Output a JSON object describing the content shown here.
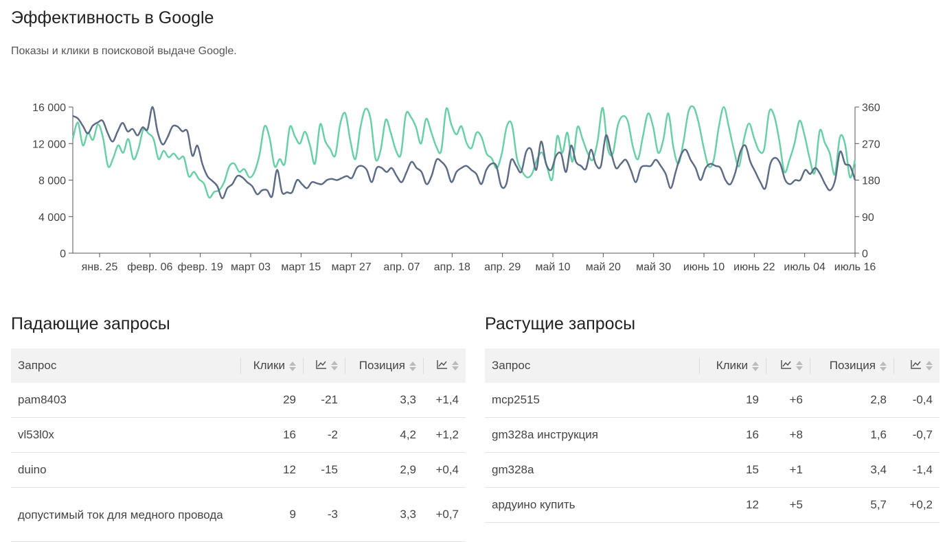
{
  "page": {
    "title": "Эффективность в Google",
    "subtitle": "Показы и клики в поисковой выдаче Google."
  },
  "colors": {
    "impressions": "#69d0a6",
    "clicks": "#5c6c85",
    "negative": "#c0392b",
    "positive": "#6aaa1e"
  },
  "chart_data": {
    "type": "line",
    "categories": [
      "янв. 25",
      "февр. 06",
      "февр. 19",
      "март 03",
      "март 15",
      "март 27",
      "апр. 07",
      "апр. 18",
      "апр. 29",
      "май 10",
      "май 20",
      "май 30",
      "июнь 10",
      "июнь 22",
      "июль 04",
      "июль 16"
    ],
    "y_left": {
      "ylim": [
        0,
        16000
      ],
      "ticks": [
        "0",
        "4 000",
        "8 000",
        "12 000",
        "16 000"
      ]
    },
    "y_right": {
      "ylim": [
        0,
        360
      ],
      "ticks": [
        "0",
        "90",
        "180",
        "270",
        "360"
      ]
    },
    "grid": false,
    "series": [
      {
        "axis": "left",
        "color": "#69d0a6",
        "values": [
          12500,
          14300,
          11800,
          13200,
          12400,
          14100,
          12600,
          9500,
          10400,
          11800,
          11000,
          12500,
          10300,
          11400,
          13600,
          13100,
          12500,
          10300,
          11200,
          10500,
          10900,
          10300,
          10500,
          8400,
          8900,
          8100,
          7600,
          6100,
          6700,
          6900,
          7800,
          9500,
          9800,
          8900,
          9200,
          8300,
          8900,
          10800,
          13900,
          12600,
          9500,
          10300,
          9800,
          13800,
          12800,
          12000,
          13300,
          11800,
          9800,
          14100,
          12300,
          11400,
          10700,
          14200,
          15300,
          12300,
          10300,
          13800,
          15800,
          14700,
          10300,
          11300,
          14600,
          13200,
          11300,
          10800,
          15200,
          14900,
          13800,
          12000,
          14700,
          13300,
          11700,
          11200,
          15800,
          14100,
          13000,
          13900,
          12100,
          11500,
          13200,
          12700,
          10900,
          10400,
          9300,
          10900,
          13900,
          14100,
          10400,
          9000,
          8300,
          8700,
          10300,
          11000,
          9400,
          8100,
          12800,
          11000,
          13200,
          10000,
          13800,
          12500,
          11000,
          10200,
          12300,
          15900,
          11500,
          10900,
          14000,
          15000,
          14400,
          11600,
          10300,
          12900,
          15300,
          13800,
          11000,
          12400,
          15300,
          11600,
          9800,
          12200,
          15500,
          16000,
          14300,
          11600,
          9500,
          10200,
          13800,
          16000,
          13800,
          11300,
          9500,
          12500,
          14200,
          12600,
          11200,
          11400,
          15500,
          15000,
          12300,
          8900,
          10200,
          12000,
          14500,
          12900,
          10400,
          8800,
          13400,
          12100,
          10900,
          8600,
          12700,
          12000,
          8300,
          10200
        ],
        "name": ""
      },
      {
        "axis": "right",
        "color": "#5c6c85",
        "values": [
          338,
          332,
          314,
          295,
          314,
          322,
          326,
          296,
          275,
          300,
          321,
          300,
          306,
          290,
          310,
          305,
          360,
          300,
          268,
          285,
          312,
          312,
          300,
          300,
          240,
          265,
          220,
          190,
          178,
          165,
          135,
          160,
          170,
          190,
          187,
          175,
          165,
          145,
          155,
          155,
          140,
          205,
          150,
          150,
          150,
          180,
          170,
          160,
          175,
          172,
          170,
          180,
          183,
          180,
          185,
          190,
          185,
          210,
          215,
          205,
          175,
          210,
          210,
          200,
          210,
          190,
          175,
          200,
          225,
          210,
          200,
          170,
          190,
          230,
          225,
          210,
          175,
          200,
          210,
          215,
          205,
          195,
          170,
          205,
          220,
          215,
          165,
          170,
          230,
          215,
          200,
          250,
          255,
          205,
          275,
          220,
          205,
          240,
          245,
          200,
          265,
          225,
          215,
          208,
          255,
          218,
          215,
          290,
          250,
          210,
          220,
          230,
          205,
          175,
          210,
          215,
          215,
          230,
          215,
          195,
          160,
          200,
          240,
          255,
          230,
          210,
          180,
          210,
          220,
          215,
          210,
          180,
          170,
          200,
          250,
          265,
          225,
          200,
          175,
          160,
          220,
          235,
          220,
          180,
          170,
          180,
          180,
          205,
          195,
          210,
          195,
          170,
          155,
          180,
          250,
          220,
          215,
          180
        ],
        "name": ""
      }
    ]
  },
  "falling": {
    "title": "Падающие запросы",
    "headers": {
      "query": "Запрос",
      "clicks": "Клики",
      "position": "Позиция"
    },
    "rows": [
      {
        "query": "pam8403",
        "clicks": "29",
        "clicks_delta": "-21",
        "position": "3,3",
        "position_delta": "+1,4"
      },
      {
        "query": "vl53l0x",
        "clicks": "16",
        "clicks_delta": "-2",
        "position": "4,2",
        "position_delta": "+1,2"
      },
      {
        "query": "duino",
        "clicks": "12",
        "clicks_delta": "-15",
        "position": "2,9",
        "position_delta": "+0,4"
      },
      {
        "query": "допустимый ток для медного провода",
        "clicks": "9",
        "clicks_delta": "-3",
        "position": "3,3",
        "position_delta": "+0,7"
      }
    ]
  },
  "rising": {
    "title": "Растущие запросы",
    "headers": {
      "query": "Запрос",
      "clicks": "Клики",
      "position": "Позиция"
    },
    "rows": [
      {
        "query": "mcp2515",
        "clicks": "19",
        "clicks_delta": "+6",
        "position": "2,8",
        "position_delta": "-0,4"
      },
      {
        "query": "gm328a инструкция",
        "clicks": "16",
        "clicks_delta": "+8",
        "position": "1,6",
        "position_delta": "-0,7"
      },
      {
        "query": "gm328a",
        "clicks": "15",
        "clicks_delta": "+1",
        "position": "3,4",
        "position_delta": "-1,4"
      },
      {
        "query": "ардуино купить",
        "clicks": "12",
        "clicks_delta": "+5",
        "position": "5,7",
        "position_delta": "+0,2"
      }
    ]
  }
}
